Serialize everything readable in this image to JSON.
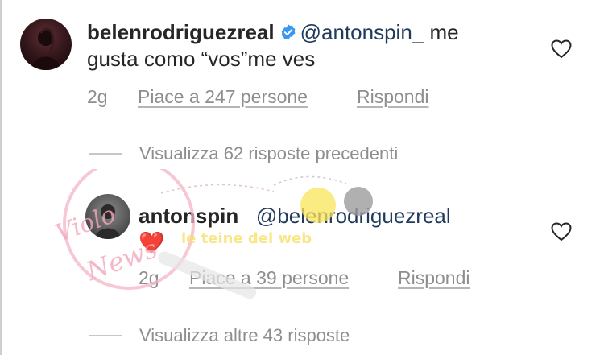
{
  "comment": {
    "username": "belenrodriguezreal",
    "mention": "@antonspin_",
    "text_line1": "me",
    "text_line2": "gusta como “vos”me ves",
    "time": "2g",
    "likes": "Piace a 247 persone",
    "reply": "Rispondi"
  },
  "view_previous": "Visualizza 62 risposte precedenti",
  "reply_comment": {
    "username": "antonspin_",
    "mention": "@belenrodriguezreal",
    "emoji": "❤️",
    "time": "2g",
    "likes": "Piace a 39 persone",
    "reply": "Rispondi"
  },
  "view_more": "Visualizza altre 43 risposte",
  "watermark": {
    "title": "Violo News",
    "subtitle": "le teine del web"
  },
  "colors": {
    "text": "#262626",
    "meta": "#8e8e8e",
    "verified": "#3897f0",
    "mention": "#1f3a5c"
  }
}
